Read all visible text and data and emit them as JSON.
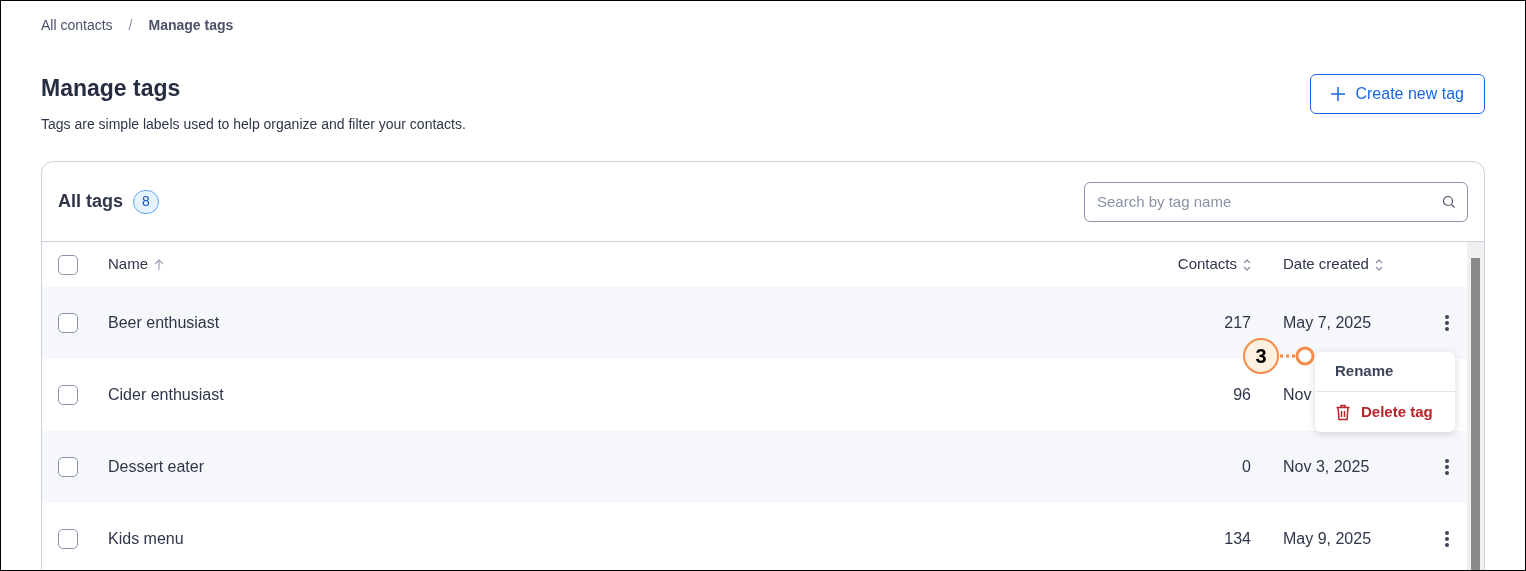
{
  "breadcrumb": [
    {
      "label": "All contacts",
      "current": false
    },
    {
      "label": "Manage tags",
      "current": true
    }
  ],
  "separator": "/",
  "title": "Manage tags",
  "subtitle": "Tags are simple labels used to help organize and filter your contacts.",
  "create_button": {
    "label": "Create new tag"
  },
  "card": {
    "title": "All tags",
    "count": "8",
    "search": {
      "placeholder": "Search by tag name"
    }
  },
  "select_all": {
    "checked": false
  },
  "columns": [
    {
      "label": "Name",
      "sorted": true
    },
    {
      "label": "Contacts",
      "sorted": false
    },
    {
      "label": "Date created",
      "sorted": false
    }
  ],
  "rows": [
    {
      "name": "Beer enthusiast",
      "contacts": "217",
      "date": "May 7, 2025",
      "checked": false,
      "menu_button": true
    },
    {
      "name": "Cider enthusiast",
      "contacts": "96",
      "date": "Nov",
      "checked": false
    },
    {
      "name": "Dessert eater",
      "contacts": "0",
      "date": "Nov 3, 2025",
      "checked": false,
      "menu_button": true
    },
    {
      "name": "Kids menu",
      "contacts": "134",
      "date": "May 9, 2025",
      "checked": false,
      "menu_button": true
    }
  ],
  "menu": {
    "open": true,
    "items": [
      {
        "kind": "rename",
        "label": "Rename"
      },
      {
        "kind": "delete",
        "label": "Delete tag"
      }
    ]
  },
  "callout": {
    "label": "3"
  }
}
